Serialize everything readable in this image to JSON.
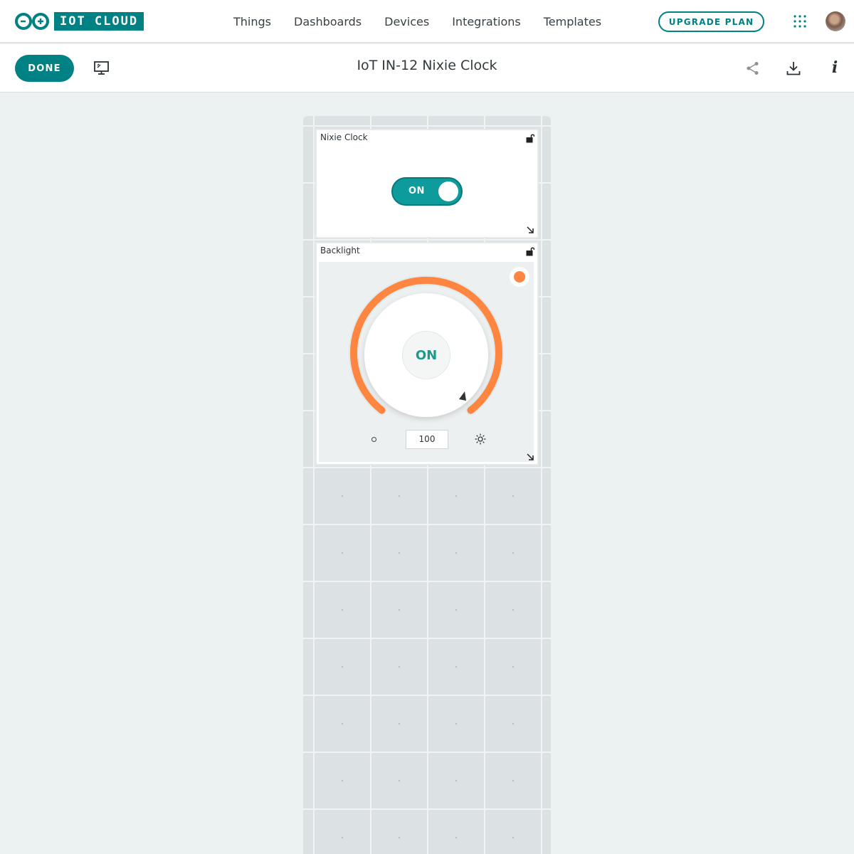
{
  "brand": {
    "name": "IOT CLOUD",
    "accent": "#008184"
  },
  "nav": {
    "links": [
      "Things",
      "Dashboards",
      "Devices",
      "Integrations",
      "Templates"
    ],
    "upgrade_label": "UPGRADE PLAN"
  },
  "subheader": {
    "done_label": "DONE",
    "title": "IoT IN-12 Nixie Clock",
    "info_label": "i"
  },
  "widgets": {
    "switch": {
      "title": "Nixie Clock",
      "state_label": "ON",
      "color": "#0d9b9c"
    },
    "dimmer": {
      "title": "Backlight",
      "state_label": "ON",
      "value": "100",
      "level_percent": 100,
      "color": "#ff8640"
    }
  },
  "icons": [
    "apps-grid-icon",
    "monitor-icon",
    "share-icon",
    "download-icon",
    "info-icon",
    "lock-icon",
    "resize-icon",
    "brightness-low-icon",
    "brightness-high-icon"
  ]
}
